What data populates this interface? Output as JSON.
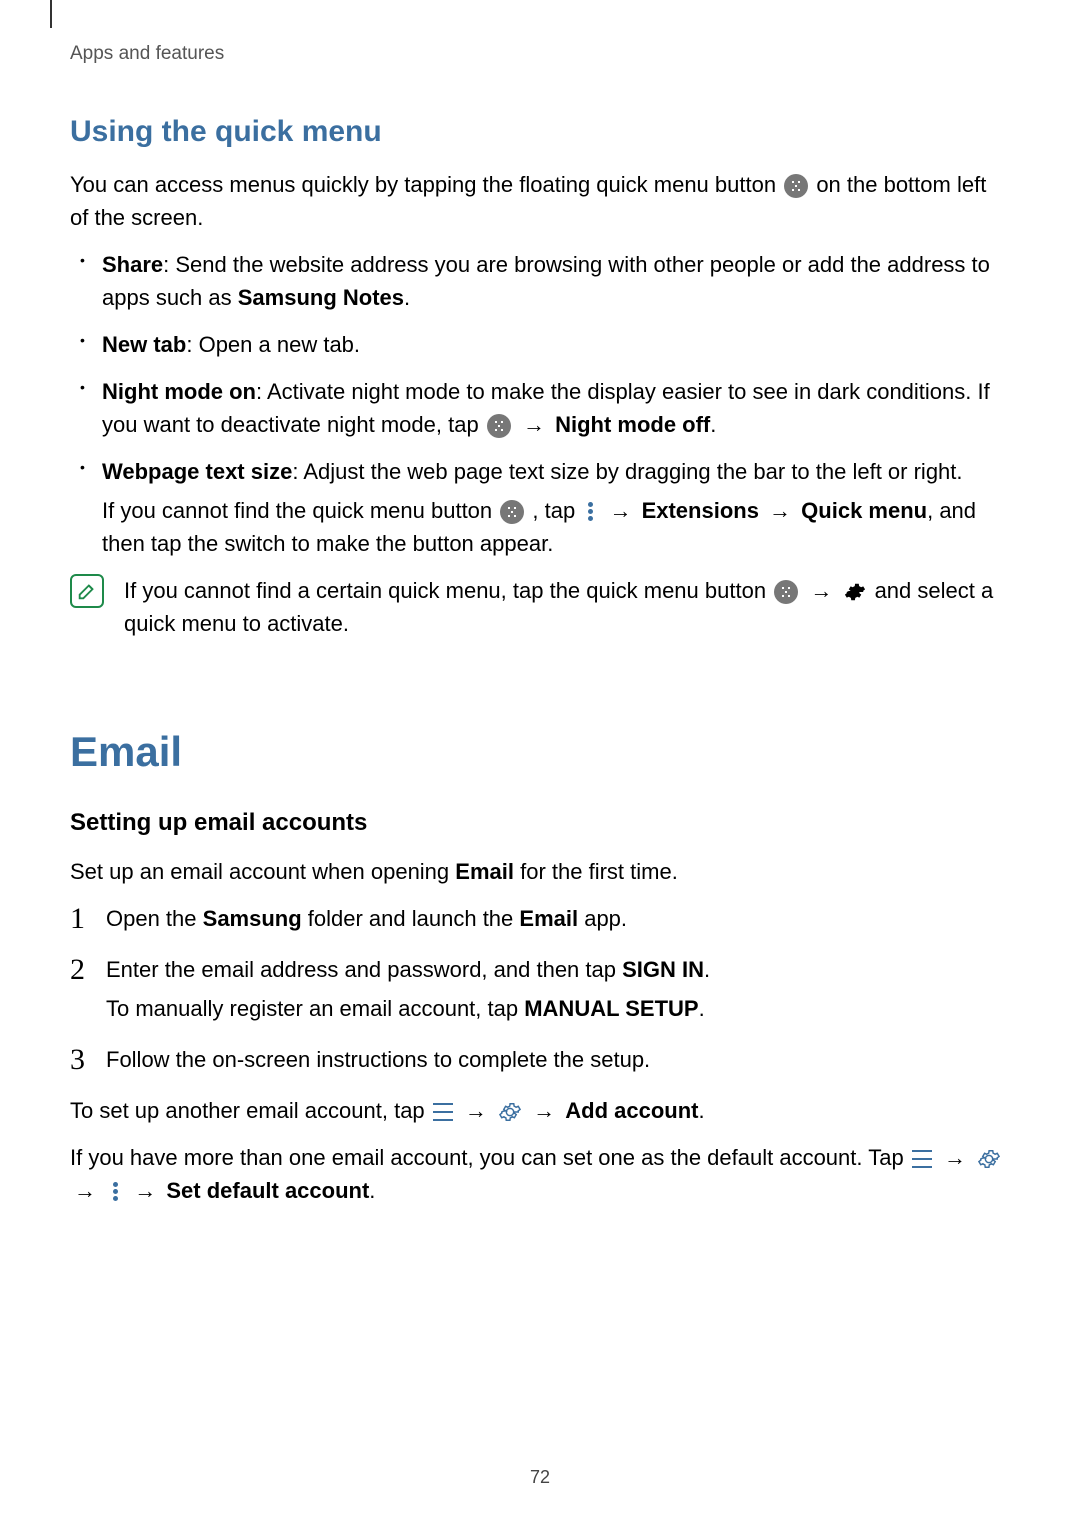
{
  "breadcrumb": "Apps and features",
  "page_number": "72",
  "quick_menu": {
    "heading": "Using the quick menu",
    "intro_1": "You can access menus quickly by tapping the floating quick menu button ",
    "intro_2": " on the bottom left of the screen.",
    "items": {
      "share": {
        "label": "Share",
        "text": ": Send the website address you are browsing with other people or add the address to apps such as ",
        "bold1": "Samsung Notes",
        "text_end": "."
      },
      "newtab": {
        "label": "New tab",
        "text": ": Open a new tab."
      },
      "night": {
        "label": "Night mode on",
        "text": ": Activate night mode to make the display easier to see in dark conditions. If you want to deactivate night mode, tap ",
        "arrow": " → ",
        "bold1": "Night mode off",
        "text_end": "."
      },
      "textsize": {
        "label": "Webpage text size",
        "text": ": Adjust the web page text size by dragging the bar to the left or right.",
        "sub1": "If you cannot find the quick menu button ",
        "sub2": ", tap ",
        "arrow1": " → ",
        "bold1": "Extensions",
        "arrow2": " → ",
        "bold2": "Quick menu",
        "sub3": ", and then tap the switch to make the button appear."
      }
    },
    "note": {
      "part1": "If you cannot find a certain quick menu, tap the quick menu button ",
      "arrow": " → ",
      "part2": " and select a quick menu to activate."
    }
  },
  "email": {
    "heading": "Email",
    "sub_heading": "Setting up email accounts",
    "intro_a": "Set up an email account when opening ",
    "intro_bold": "Email",
    "intro_b": " for the first time.",
    "steps": {
      "s1": {
        "num": "1",
        "a": "Open the ",
        "b1": "Samsung",
        "b": " folder and launch the ",
        "b2": "Email",
        "c": " app."
      },
      "s2": {
        "num": "2",
        "a": "Enter the email address and password, and then tap ",
        "b1": "SIGN IN",
        "b": ".",
        "sub_a": "To manually register an email account, tap ",
        "sub_b1": "MANUAL SETUP",
        "sub_b": "."
      },
      "s3": {
        "num": "3",
        "a": "Follow the on-screen instructions to complete the setup."
      }
    },
    "para2": {
      "a": "To set up another email account, tap ",
      "arrow1": " → ",
      "arrow2": " → ",
      "b1": "Add account",
      "b": "."
    },
    "para3": {
      "a": "If you have more than one email account, you can set one as the default account. Tap ",
      "arrow1": " → ",
      "arrow2": " → ",
      "arrow3": " → ",
      "b1": "Set default account",
      "b": "."
    }
  }
}
